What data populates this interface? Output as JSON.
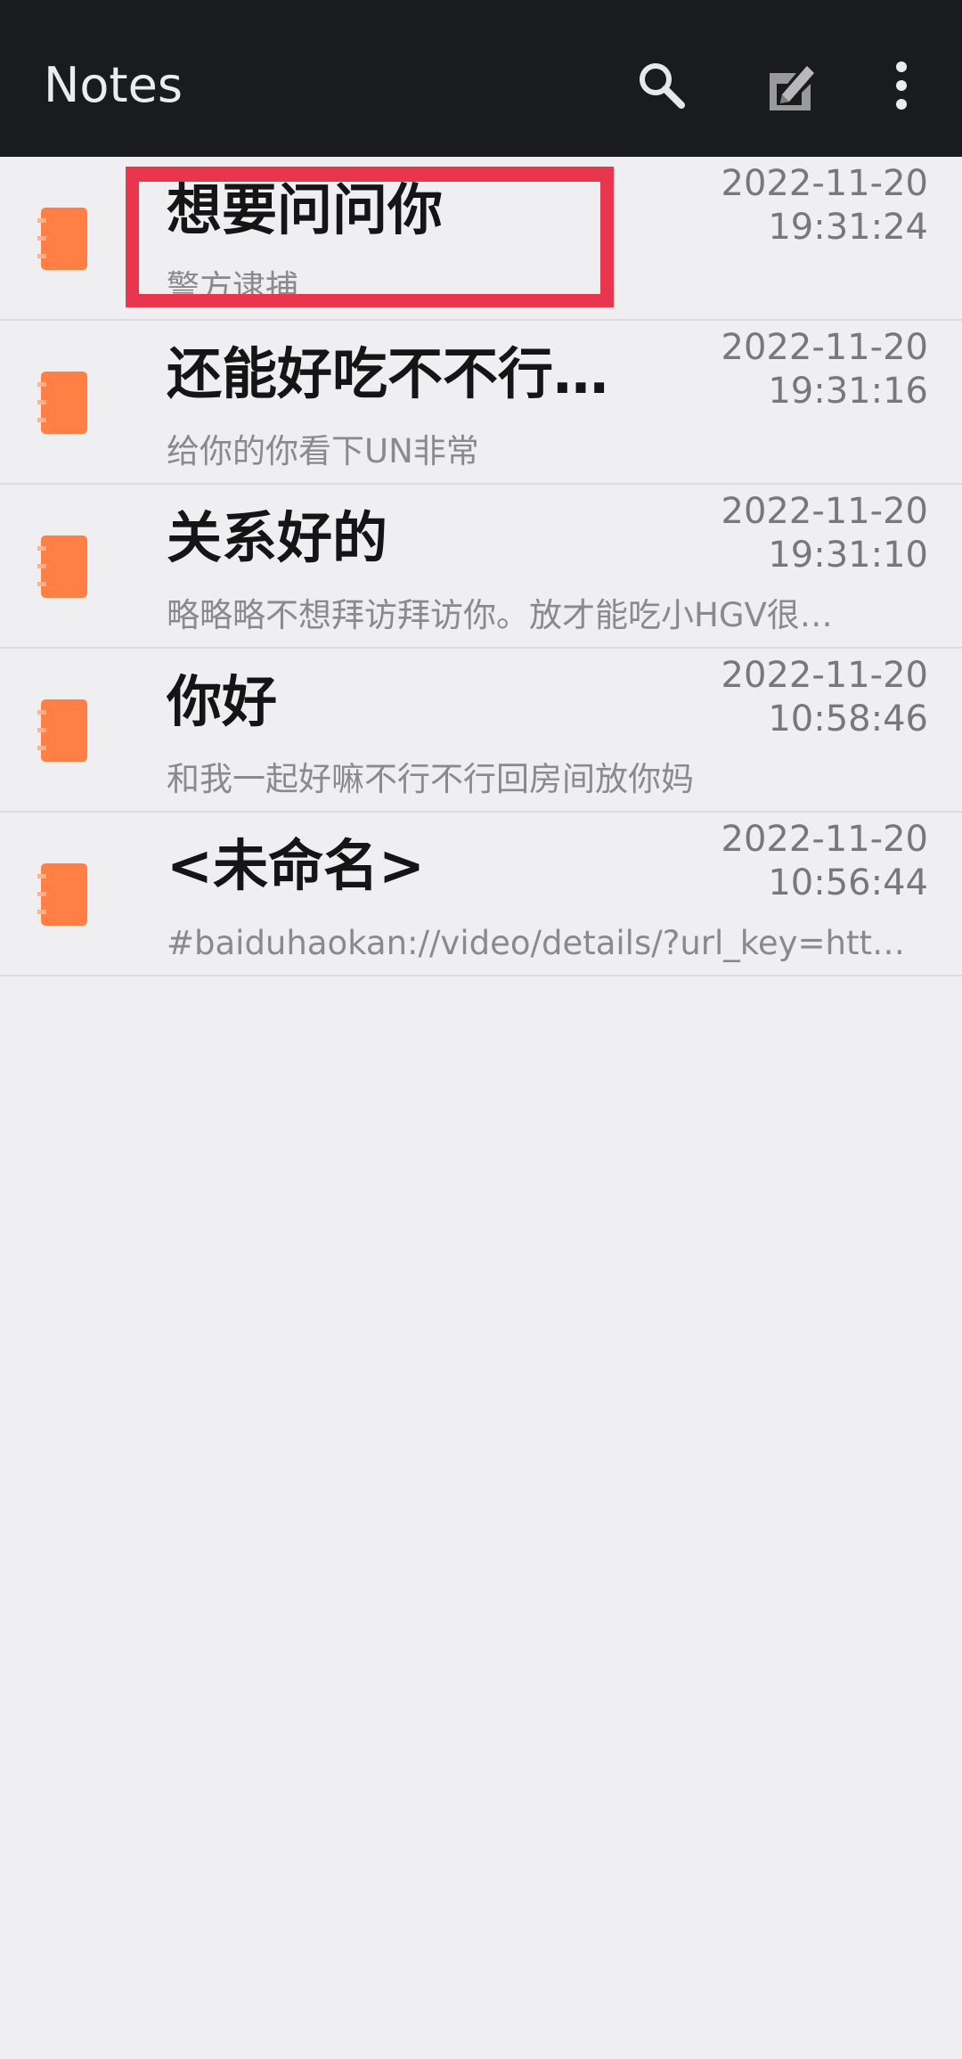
{
  "app": {
    "title": "Notes",
    "background_color": "#efeff2",
    "toolbar_color": "#1a1b1e",
    "accent_icon_color": "#ff7f45",
    "highlight_color": "#e8364f"
  },
  "toolbar": {
    "search_icon": "search-icon",
    "new_note_icon": "new-note-icon",
    "more_icon": "more-vertical-icon"
  },
  "notes": [
    {
      "title": "想要问问你",
      "preview": "警方逮捕",
      "date": "2022-11-20",
      "time": "19:31:24",
      "highlighted": true
    },
    {
      "title": "还能好吃不不行…",
      "preview": "给你的你看下UN非常",
      "date": "2022-11-20",
      "time": "19:31:16",
      "highlighted": false
    },
    {
      "title": "关系好的",
      "preview": "略略略不想拜访拜访你。放才能吃小HGV很…",
      "date": "2022-11-20",
      "time": "19:31:10",
      "highlighted": false
    },
    {
      "title": "你好",
      "preview": "和我一起好嘛不行不行回房间放你妈",
      "date": "2022-11-20",
      "time": "10:58:46",
      "highlighted": false
    },
    {
      "title": "<未命名>",
      "preview": "#baiduhaokan://video/details/?url_key=http…",
      "date": "2022-11-20",
      "time": "10:56:44",
      "highlighted": false
    }
  ]
}
